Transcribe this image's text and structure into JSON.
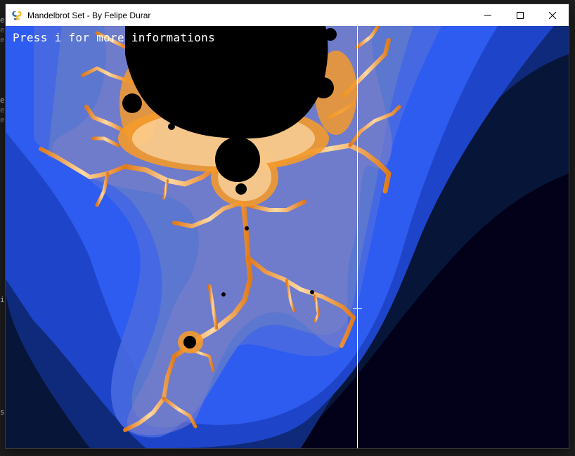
{
  "window": {
    "title": "Mandelbrot Set - By Felipe Durar",
    "controls": {
      "minimize": "minimize-icon",
      "maximize": "maximize-icon",
      "close": "close-icon"
    }
  },
  "canvas": {
    "overlay_text": "Press i for more informations",
    "colors": {
      "set_interior": "#000000",
      "edge_orange": "#f39a2c",
      "edge_white": "#fff1d6",
      "blue_bright": "#2f5cf0",
      "blue_mid": "#1e45c9",
      "blue_dark": "#0f2a7a",
      "navy": "#071538",
      "deep": "#03001a"
    }
  },
  "background_app": {
    "fragments": [
      "e",
      "e",
      "e",
      "e",
      "e",
      "e",
      "i",
      "s"
    ]
  }
}
